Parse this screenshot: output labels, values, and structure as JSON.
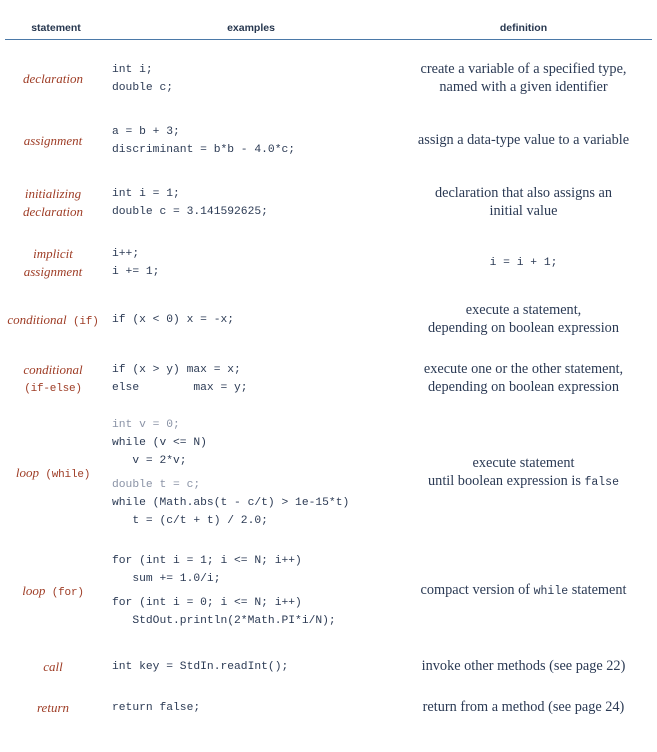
{
  "table": {
    "headers": {
      "statement": "statement",
      "examples": "examples",
      "definition": "definition"
    },
    "colors": {
      "rule": "#4b79a8",
      "header_text": "#27374f",
      "statement_label": "#9e3c25",
      "body_text": "#2b3a54",
      "dim_code": "#8a93a6"
    },
    "rows": [
      {
        "id": "declaration",
        "statement_kw": "declaration",
        "statement_mono": "",
        "statement_line2_kw": "",
        "statement_line2_mono": "",
        "examples": [
          "int i;",
          "double c;"
        ],
        "examples_dim": [
          false,
          false
        ],
        "definition_lines": [
          "create a variable of a specified type,",
          "named with a given identifier"
        ],
        "definition_is_code": false
      },
      {
        "id": "assignment",
        "statement_kw": "assignment",
        "statement_mono": "",
        "statement_line2_kw": "",
        "statement_line2_mono": "",
        "examples": [
          "a = b + 3;",
          "discriminant = b*b - 4.0*c;"
        ],
        "examples_dim": [
          false,
          false
        ],
        "definition_lines": [
          "assign a data-type value to a variable"
        ],
        "definition_is_code": false
      },
      {
        "id": "initializing-declaration",
        "statement_kw": "initializing",
        "statement_mono": "",
        "statement_line2_kw": "declaration",
        "statement_line2_mono": "",
        "examples": [
          "int i = 1;",
          "double c = 3.141592625;"
        ],
        "examples_dim": [
          false,
          false
        ],
        "definition_lines": [
          "declaration that also assigns an",
          "initial value"
        ],
        "definition_is_code": false
      },
      {
        "id": "implicit-assignment",
        "statement_kw": "implicit",
        "statement_mono": "",
        "statement_line2_kw": "assignment",
        "statement_line2_mono": "",
        "examples": [
          "i++;",
          "i += 1;"
        ],
        "examples_dim": [
          false,
          false
        ],
        "definition_lines": [
          "i = i + 1;"
        ],
        "definition_is_code": true
      },
      {
        "id": "conditional-if",
        "statement_kw": "conditional",
        "statement_mono": " (if)",
        "statement_line2_kw": "",
        "statement_line2_mono": "",
        "examples": [
          "if (x < 0) x = -x;"
        ],
        "examples_dim": [
          false
        ],
        "definition_lines": [
          "execute a statement,",
          "depending on boolean expression"
        ],
        "definition_is_code": false
      },
      {
        "id": "conditional-if-else",
        "statement_kw": "conditional",
        "statement_mono": "",
        "statement_line2_kw": "",
        "statement_line2_mono": "(if-else)",
        "examples": [
          "if (x > y) max = x;",
          "else        max = y;"
        ],
        "examples_dim": [
          false,
          false
        ],
        "definition_lines": [
          "execute one or the other statement,",
          "depending on boolean expression"
        ],
        "definition_is_code": false
      },
      {
        "id": "loop-while",
        "statement_kw": "loop",
        "statement_mono": " (while)",
        "statement_line2_kw": "",
        "statement_line2_mono": "",
        "examples": [
          "int v = 0;",
          "while (v <= N)",
          "   v = 2*v;",
          "double t = c;",
          "while (Math.abs(t - c/t) > 1e-15*t)",
          "   t = (c/t + t) / 2.0;"
        ],
        "examples_dim": [
          true,
          false,
          false,
          true,
          false,
          false
        ],
        "definition_lines": [
          "execute statement",
          "until boolean expression is false"
        ],
        "definition_mono_token": "false",
        "definition_is_code": false
      },
      {
        "id": "loop-for",
        "statement_kw": "loop",
        "statement_mono": " (for)",
        "statement_line2_kw": "",
        "statement_line2_mono": "",
        "examples": [
          "for (int i = 1; i <= N; i++)",
          "   sum += 1.0/i;",
          "for (int i = 0; i <= N; i++)",
          "   StdOut.println(2*Math.PI*i/N);"
        ],
        "examples_dim": [
          false,
          false,
          false,
          false
        ],
        "definition_lines": [
          "compact version of while statement"
        ],
        "definition_mono_token": "while",
        "definition_is_code": false
      },
      {
        "id": "call",
        "statement_kw": "call",
        "statement_mono": "",
        "statement_line2_kw": "",
        "statement_line2_mono": "",
        "examples": [
          "int key = StdIn.readInt();"
        ],
        "examples_dim": [
          false
        ],
        "definition_lines": [
          "invoke other methods (see page 22)"
        ],
        "definition_is_code": false
      },
      {
        "id": "return",
        "statement_kw": "return",
        "statement_mono": "",
        "statement_line2_kw": "",
        "statement_line2_mono": "",
        "examples": [
          "return false;"
        ],
        "examples_dim": [
          false
        ],
        "definition_lines": [
          "return from a method (see page 24)"
        ],
        "definition_is_code": false
      }
    ]
  }
}
